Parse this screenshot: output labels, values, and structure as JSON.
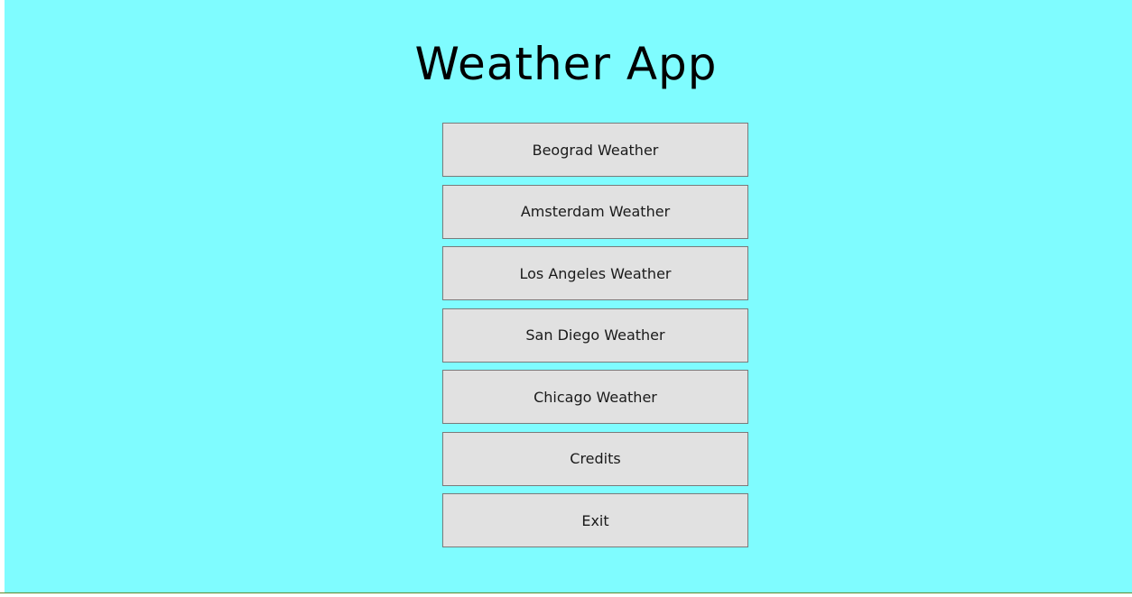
{
  "app": {
    "title": "Weather App"
  },
  "menu": {
    "buttons": [
      {
        "label": "Beograd Weather"
      },
      {
        "label": "Amsterdam Weather"
      },
      {
        "label": "Los Angeles Weather"
      },
      {
        "label": "San Diego Weather"
      },
      {
        "label": "Chicago Weather"
      },
      {
        "label": "Credits"
      },
      {
        "label": "Exit"
      }
    ]
  },
  "colors": {
    "background": "#7ffcff",
    "button_face": "#e1e1e1",
    "button_border": "#7a7a7a"
  }
}
